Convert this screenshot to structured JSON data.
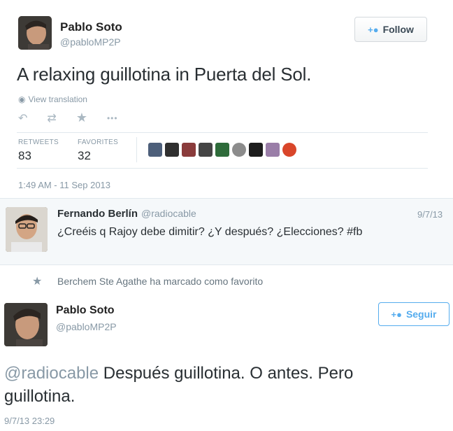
{
  "tweet": {
    "author_name": "Pablo Soto",
    "author_handle": "@pabloMP2P",
    "follow_label": "Follow",
    "text": "A relaxing guillotina in Puerta del Sol.",
    "view_translation": "View translation",
    "actions": [
      "reply-icon",
      "retweet-icon",
      "favorite-icon",
      "more-icon"
    ],
    "stats": {
      "retweets_label": "RETWEETS",
      "retweets_value": "83",
      "favorites_label": "FAVORITES",
      "favorites_value": "32"
    },
    "timestamp": "1:49 AM - 11 Sep 2013"
  },
  "reply": {
    "author_name": "Fernando Berlín",
    "author_handle": "@radiocable",
    "date": "9/7/13",
    "text": "¿Creéis q Rajoy debe dimitir? ¿Y después? ¿Elecciones? #fb"
  },
  "favorite_notice": {
    "text": "Berchem Ste Agathe ha marcado como favorito"
  },
  "second_tweet": {
    "author_name": "Pablo Soto",
    "author_handle": "@pabloMP2P",
    "follow_label": "Seguir",
    "mention": "@radiocable",
    "text": " Después guillotina. O antes. Pero guillotina.",
    "timestamp": "9/7/13 23:29"
  },
  "colors": {
    "accent": "#55acee",
    "grey_text": "#8899a6",
    "body_text": "#292f33"
  }
}
